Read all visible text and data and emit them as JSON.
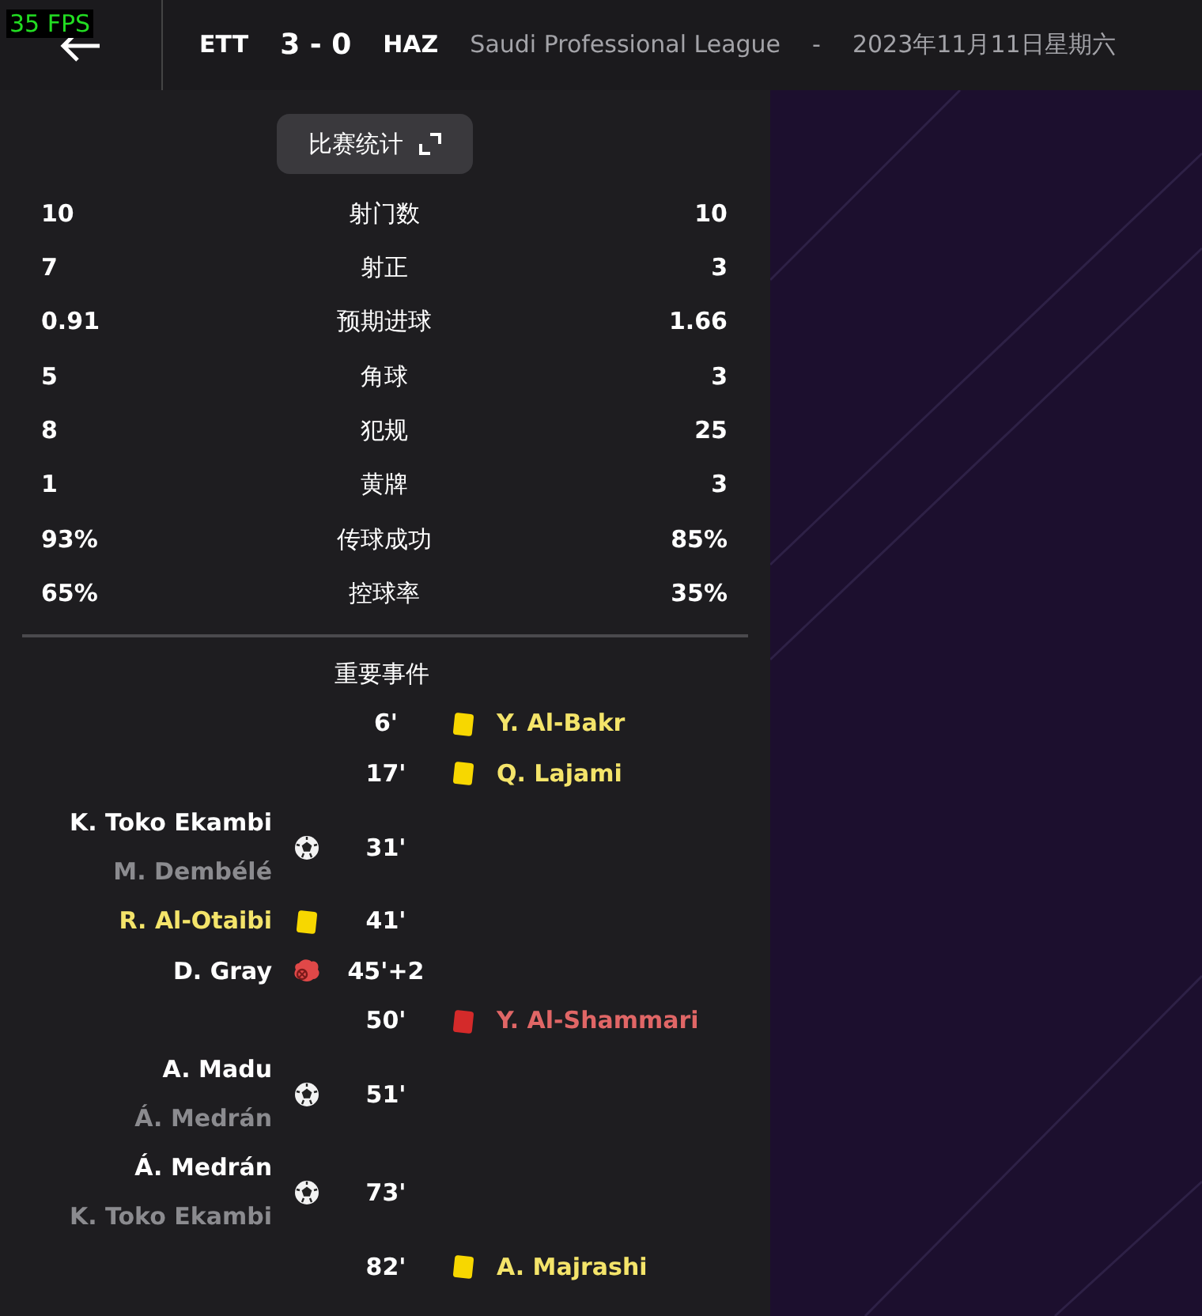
{
  "fps_overlay": "35 FPS",
  "header": {
    "home": "ETT",
    "score": "3 - 0",
    "away": "HAZ",
    "competition": "Saudi Professional League",
    "separator": "-",
    "date": "2023年11月11日星期六"
  },
  "stats_button": {
    "label": "比赛统计"
  },
  "stats": [
    {
      "home": "10",
      "label": "射门数",
      "away": "10"
    },
    {
      "home": "7",
      "label": "射正",
      "away": "3"
    },
    {
      "home": "0.91",
      "label": "预期进球",
      "away": "1.66"
    },
    {
      "home": "5",
      "label": "角球",
      "away": "3"
    },
    {
      "home": "8",
      "label": "犯规",
      "away": "25"
    },
    {
      "home": "1",
      "label": "黄牌",
      "away": "3"
    },
    {
      "home": "93%",
      "label": "传球成功",
      "away": "85%"
    },
    {
      "home": "65%",
      "label": "控球率",
      "away": "35%"
    }
  ],
  "events_title": "重要事件",
  "events": [
    {
      "home_team": false,
      "kind": "yellow",
      "minute": "6'",
      "player": "Y. Al-Bakr"
    },
    {
      "home_team": false,
      "kind": "yellow",
      "minute": "17'",
      "player": "Q. Lajami"
    },
    {
      "home_team": true,
      "kind": "goal",
      "minute": "31'",
      "player": "K. Toko Ekambi",
      "assist": "M. Dembélé"
    },
    {
      "home_team": true,
      "kind": "yellow",
      "minute": "41'",
      "player": "R. Al-Otaibi"
    },
    {
      "home_team": true,
      "kind": "injury",
      "minute": "45'+2",
      "player": "D. Gray"
    },
    {
      "home_team": false,
      "kind": "red",
      "minute": "50'",
      "player": "Y. Al-Shammari"
    },
    {
      "home_team": true,
      "kind": "goal",
      "minute": "51'",
      "player": "A. Madu",
      "assist": "Á. Medrán"
    },
    {
      "home_team": true,
      "kind": "goal",
      "minute": "73'",
      "player": "Á. Medrán",
      "assist": "K. Toko Ekambi"
    },
    {
      "home_team": false,
      "kind": "yellow",
      "minute": "82'",
      "player": "A. Majrashi"
    }
  ]
}
